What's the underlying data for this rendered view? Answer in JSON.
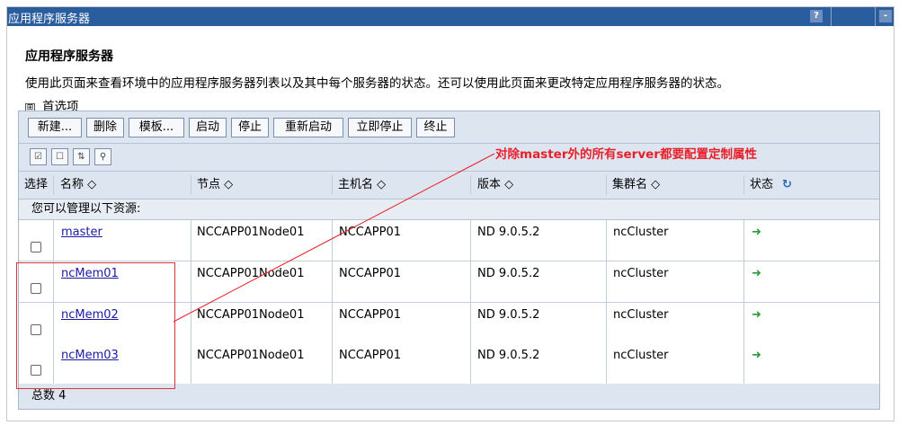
{
  "window": {
    "title": "应用程序服务器",
    "help_label": "?",
    "min_label": "-"
  },
  "page": {
    "heading": "应用程序服务器",
    "description": "使用此页面来查看环境中的应用程序服务器列表以及其中每个服务器的状态。还可以使用此页面来更改特定应用程序服务器的状态。",
    "preferences_toggle": "⊞",
    "preferences_label": "首选项"
  },
  "toolbar": {
    "buttons": [
      "新建...",
      "删除",
      "模板...",
      "启动",
      "停止",
      "重新启动",
      "立即停止",
      "终止"
    ]
  },
  "iconbar": {
    "icons": [
      "select-all-icon",
      "deselect-all-icon",
      "filter-icon",
      "show-filter-icon"
    ]
  },
  "table": {
    "columns": {
      "select": "选择",
      "name": "名称 ◇",
      "node": "节点 ◇",
      "host": "主机名 ◇",
      "version": "版本 ◇",
      "cluster": "集群名 ◇",
      "status": "状态"
    },
    "status_icon": "↻",
    "section_label": "您可以管理以下资源:",
    "rows": [
      {
        "name": "master",
        "node": "NCCAPP01Node01",
        "host": "NCCAPP01",
        "version": "ND 9.0.5.2",
        "cluster": "ncCluster",
        "status": "started"
      },
      {
        "name": "ncMem01",
        "node": "NCCAPP01Node01",
        "host": "NCCAPP01",
        "version": "ND 9.0.5.2",
        "cluster": "ncCluster",
        "status": "started"
      },
      {
        "name": "ncMem02",
        "node": "NCCAPP01Node01",
        "host": "NCCAPP01",
        "version": "ND 9.0.5.2",
        "cluster": "ncCluster",
        "status": "started"
      },
      {
        "name": "ncMem03",
        "node": "NCCAPP01Node01",
        "host": "NCCAPP01",
        "version": "ND 9.0.5.2",
        "cluster": "ncCluster",
        "status": "started"
      }
    ],
    "status_arrow": "➜",
    "total_label": "总数 4"
  },
  "annotation": {
    "text": "对除master外的所有server都要配置定制属性",
    "color": "#e8202a"
  }
}
